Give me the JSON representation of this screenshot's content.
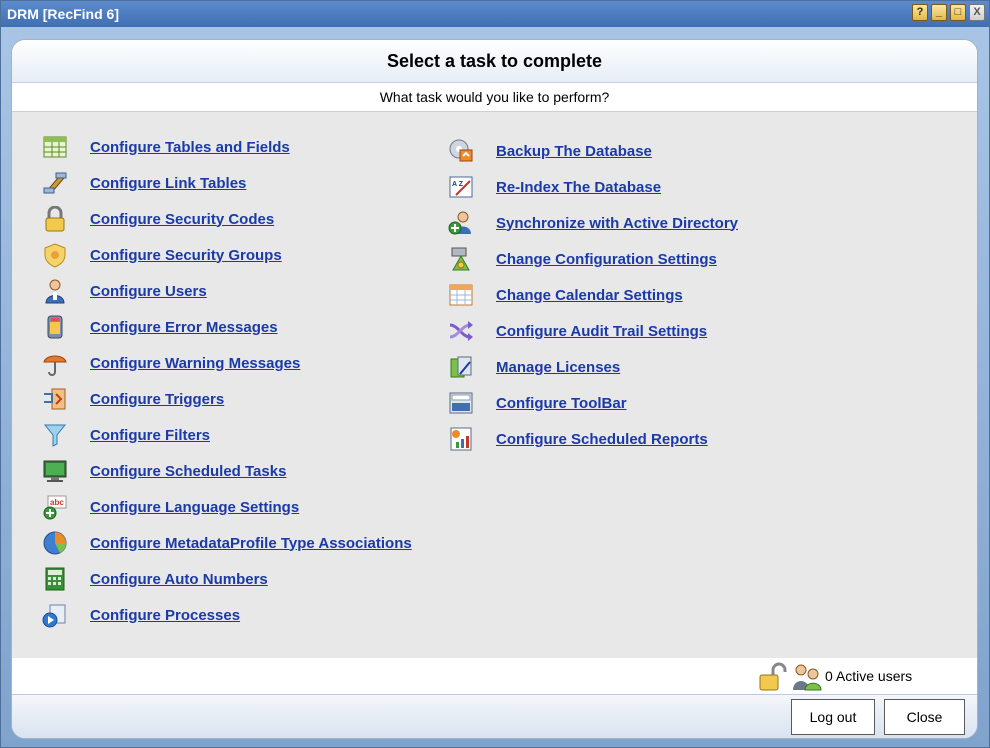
{
  "window": {
    "title": "DRM [RecFind 6]",
    "controls": [
      "?",
      "_",
      "□",
      "X"
    ]
  },
  "header": {
    "title": "Select a task to complete",
    "prompt": "What task would you like to perform?"
  },
  "tasks_left": [
    {
      "label": "Configure Tables and Fields",
      "icon": "table-icon"
    },
    {
      "label": "Configure Link Tables",
      "icon": "link-tables-icon"
    },
    {
      "label": "Configure Security Codes",
      "icon": "padlock-icon"
    },
    {
      "label": "Configure Security Groups",
      "icon": "shield-icon"
    },
    {
      "label": "Configure Users",
      "icon": "user-icon"
    },
    {
      "label": "Configure Error Messages",
      "icon": "error-icon"
    },
    {
      "label": "Configure Warning Messages",
      "icon": "umbrella-icon"
    },
    {
      "label": "Configure Triggers",
      "icon": "trigger-icon"
    },
    {
      "label": "Configure Filters",
      "icon": "filter-icon"
    },
    {
      "label": "Configure Scheduled Tasks",
      "icon": "monitor-icon"
    },
    {
      "label": "Configure Language Settings",
      "icon": "language-icon"
    },
    {
      "label": "Configure MetadataProfile Type Associations",
      "icon": "pie-icon"
    },
    {
      "label": "Configure Auto Numbers",
      "icon": "calculator-icon"
    },
    {
      "label": "Configure Processes",
      "icon": "processes-icon"
    }
  ],
  "tasks_right": [
    {
      "label": "Backup The Database",
      "icon": "backup-icon"
    },
    {
      "label": "Re-Index The Database",
      "icon": "reindex-icon"
    },
    {
      "label": "Synchronize with Active Directory",
      "icon": "sync-directory-icon"
    },
    {
      "label": "Change Configuration Settings",
      "icon": "config-icon"
    },
    {
      "label": "Change Calendar Settings",
      "icon": "calendar-icon"
    },
    {
      "label": "Configure Audit Trail Settings",
      "icon": "shuffle-icon"
    },
    {
      "label": "Manage Licenses",
      "icon": "license-icon"
    },
    {
      "label": "Configure ToolBar",
      "icon": "toolbar-icon"
    },
    {
      "label": "Configure Scheduled Reports",
      "icon": "report-icon"
    }
  ],
  "status": {
    "active_users": "0 Active users"
  },
  "footer": {
    "logout_label": "Log out",
    "close_label": "Close"
  },
  "colors": {
    "link": "#1a3aa8",
    "titlebar": "#4a7bbd"
  }
}
